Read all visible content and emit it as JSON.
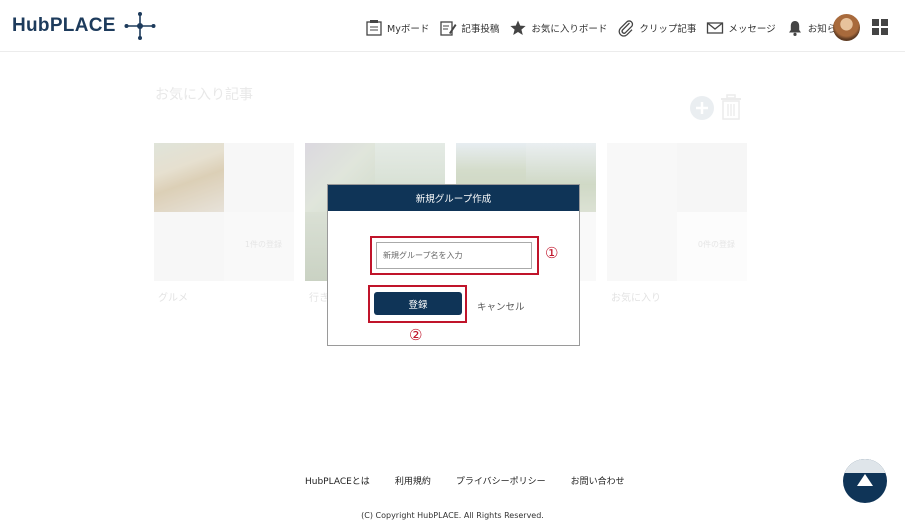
{
  "header": {
    "logo_text": "HubPLACE",
    "nav": [
      {
        "label": "Myボード",
        "icon": "board-icon"
      },
      {
        "label": "記事投稿",
        "icon": "edit-icon"
      },
      {
        "label": "お気に入りボード",
        "icon": "star-icon"
      },
      {
        "label": "クリップ記事",
        "icon": "paperclip-icon"
      },
      {
        "label": "メッセージ",
        "icon": "mail-icon"
      },
      {
        "label": "お知らせ",
        "icon": "bell-icon"
      }
    ]
  },
  "page": {
    "title": "お気に入り記事",
    "cards": [
      {
        "name": "グルメ",
        "count": "1件の登録"
      },
      {
        "name": "行き",
        "count": ""
      },
      {
        "name": "",
        "count": ""
      },
      {
        "name": "お気に入り",
        "count": "0件の登録"
      }
    ]
  },
  "modal": {
    "title": "新規グループ作成",
    "input_placeholder": "新規グループ名を入力",
    "register_label": "登録",
    "cancel_label": "キャンセル",
    "marker_1": "①",
    "marker_2": "②"
  },
  "footer": {
    "links": [
      "HubPLACEとは",
      "利用規約",
      "プライバシーポリシー",
      "お問い合わせ"
    ],
    "copyright": "(C) Copyright HubPLACE. All Rights Reserved."
  },
  "colors": {
    "brand_navy": "#0f3457",
    "annotation_red": "#c0142a"
  }
}
